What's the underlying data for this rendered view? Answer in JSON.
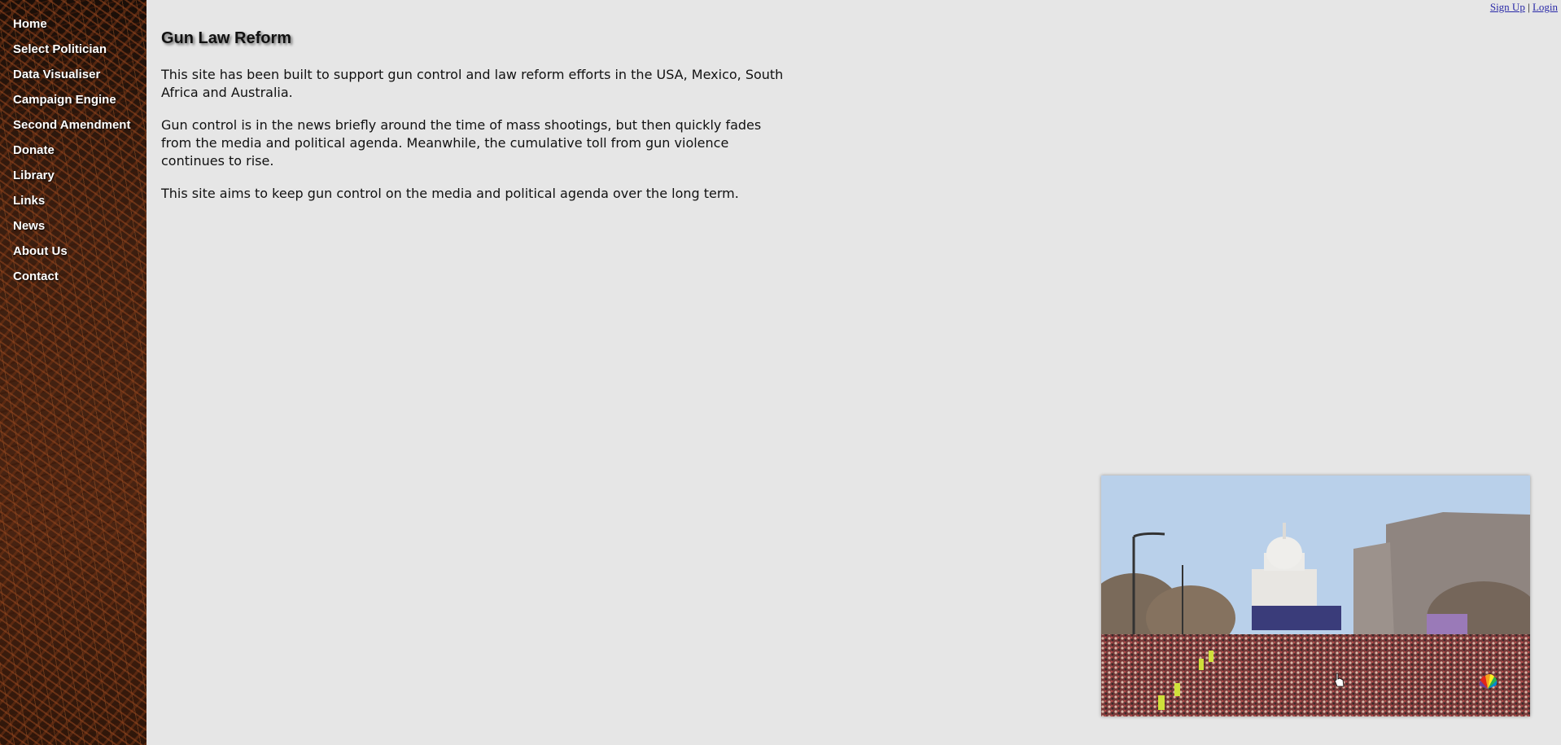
{
  "nav": {
    "items": [
      {
        "label": "Home"
      },
      {
        "label": "Select Politician"
      },
      {
        "label": "Data Visualiser"
      },
      {
        "label": "Campaign Engine"
      },
      {
        "label": "Second Amendment"
      },
      {
        "label": "Donate"
      },
      {
        "label": "Library"
      },
      {
        "label": "Links"
      },
      {
        "label": "News"
      },
      {
        "label": "About Us"
      },
      {
        "label": "Contact"
      }
    ]
  },
  "auth": {
    "signup_label": "Sign Up",
    "separator": "|",
    "login_label": "Login"
  },
  "main": {
    "title": "Gun Law Reform",
    "paragraphs": [
      "This site has been built to support gun control and law reform efforts in the USA, Mexico, South Africa and Australia.",
      "Gun control is in the news briefly around the time of mass shootings, but then quickly fades from the media and political agenda. Meanwhile, the cumulative toll from gun violence continues to rise.",
      "This site aims to keep gun control on the media and political agenda over the long term."
    ]
  },
  "video": {
    "icon": "nbc-peacock-icon"
  },
  "colors": {
    "page_background": "#e6e6e6",
    "link": "#2a2aa8",
    "sidebar_base": "#2a1810"
  }
}
